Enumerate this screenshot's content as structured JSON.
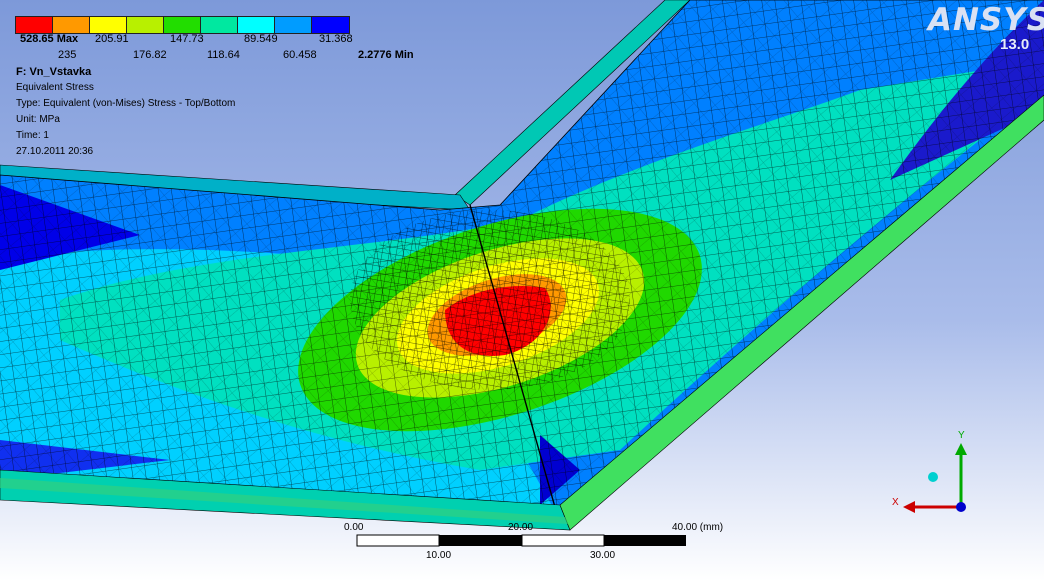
{
  "legend": {
    "colors": [
      "#ff0000",
      "#ff9900",
      "#ffff00",
      "#b8f000",
      "#22dd00",
      "#00e8a0",
      "#00ffff",
      "#009cff",
      "#0000ff"
    ],
    "values_top": [
      "528.65 Max",
      "205.91",
      "147.73",
      "89.549",
      "31.368"
    ],
    "values_bottom": [
      "235",
      "176.82",
      "118.64",
      "60.458",
      "2.2776 Min"
    ]
  },
  "result": {
    "name": "F: Vn_Vstavka",
    "title": "Equivalent Stress",
    "type": "Type: Equivalent (von-Mises) Stress - Top/Bottom",
    "unit": "Unit: MPa",
    "time": "Time: 1",
    "date": "27.10.2011 20:36"
  },
  "brand": {
    "logo": "ANSYS",
    "version": "13.0"
  },
  "scale": {
    "top_labels": [
      "0.00",
      "20.00",
      "40.00 (mm)"
    ],
    "bottom_labels": [
      "10.00",
      "30.00"
    ]
  },
  "triad": {
    "x": "X",
    "y": "Y",
    "x_color": "#cc0000",
    "y_color": "#00aa00",
    "z_color": "#0000cc"
  }
}
